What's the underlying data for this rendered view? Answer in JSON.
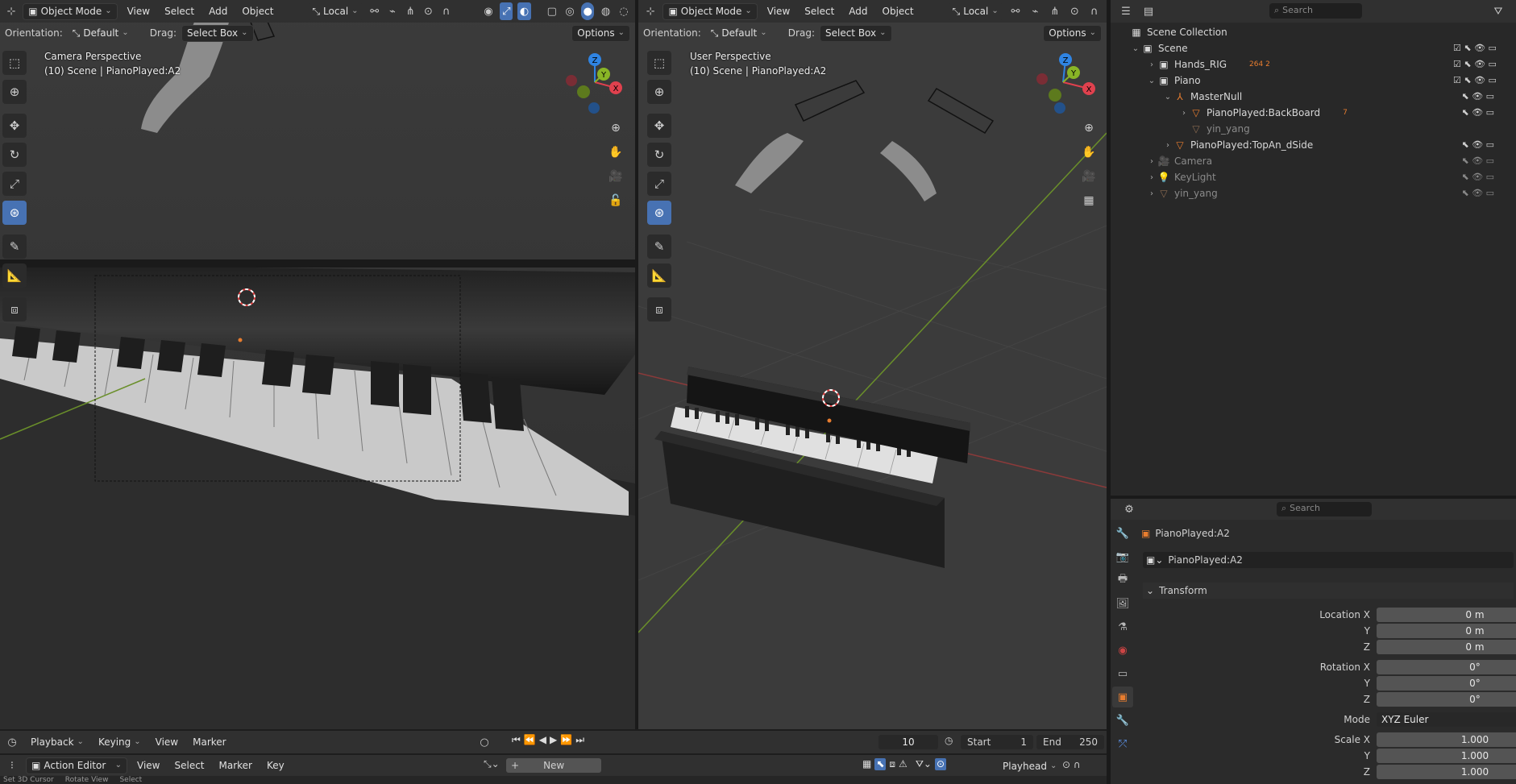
{
  "left_view": {
    "header": {
      "mode": "Object Mode",
      "menus": [
        "View",
        "Select",
        "Add",
        "Object"
      ],
      "transform_space": "Local"
    },
    "subheader": {
      "orientation_label": "Orientation:",
      "orientation_value": "Default",
      "drag_label": "Drag:",
      "drag_value": "Select Box",
      "options": "Options"
    },
    "overlay": {
      "view_name": "Camera Perspective",
      "scene_line": "(10) Scene | PianoPlayed:A2"
    },
    "gizmo": {
      "x": "X",
      "y": "Y",
      "z": "Z"
    }
  },
  "right_view": {
    "header": {
      "mode": "Object Mode",
      "menus": [
        "View",
        "Select",
        "Add",
        "Object"
      ],
      "transform_space": "Local"
    },
    "subheader": {
      "orientation_label": "Orientation:",
      "orientation_value": "Default",
      "drag_label": "Drag:",
      "drag_value": "Select Box",
      "options": "Options"
    },
    "overlay": {
      "view_name": "User Perspective",
      "scene_line": "(10) Scene | PianoPlayed:A2"
    },
    "gizmo": {
      "x": "X",
      "y": "Y",
      "z": "Z"
    }
  },
  "outliner": {
    "search_placeholder": "Search",
    "root": "Scene Collection",
    "rows": [
      {
        "label": "Scene",
        "badges": ""
      },
      {
        "label": "Hands_RIG",
        "badges": "264  2"
      },
      {
        "label": "Piano",
        "badges": ""
      },
      {
        "label": "MasterNull",
        "badges": ""
      },
      {
        "label": "PianoPlayed:BackBoard",
        "badges": "7"
      },
      {
        "label": "yin_yang",
        "badges": ""
      },
      {
        "label": "PianoPlayed:TopAn_dSide",
        "badges": ""
      },
      {
        "label": "Camera",
        "badges": ""
      },
      {
        "label": "KeyLight",
        "badges": ""
      },
      {
        "label": "yin_yang",
        "badges": ""
      }
    ]
  },
  "properties": {
    "search_placeholder": "Search",
    "object_name": "PianoPlayed:A2",
    "datablock_name": "PianoPlayed:A2",
    "panel_title": "Transform",
    "location": {
      "x_label": "Location X",
      "y_label": "Y",
      "z_label": "Z",
      "x": "0 m",
      "y": "0 m",
      "z": "0 m"
    },
    "rotation": {
      "x_label": "Rotation X",
      "y_label": "Y",
      "z_label": "Z",
      "x": "0°",
      "y": "0°",
      "z": "0°"
    },
    "mode": {
      "label": "Mode",
      "value": "XYZ Euler"
    },
    "scale": {
      "x_label": "Scale X",
      "y_label": "Y",
      "z_label": "Z",
      "x": "1.000",
      "y": "1.000",
      "z": "1.000"
    }
  },
  "timeline": {
    "menus": [
      "Playback",
      "Keying",
      "View",
      "Marker"
    ],
    "current_frame": "10",
    "start_label": "Start",
    "start": "1",
    "end_label": "End",
    "end": "250"
  },
  "action_editor": {
    "editor": "Action Editor",
    "menus": [
      "View",
      "Select",
      "Marker",
      "Key"
    ],
    "new_label": "New",
    "playhead": "Playhead"
  },
  "status_bar": {
    "items": [
      "Set 3D Cursor",
      "Rotate View",
      "Select"
    ]
  },
  "colors": {
    "accent": "#4772b3",
    "axis_x": "#e0414e",
    "axis_y": "#89b526",
    "axis_z": "#2f84e3",
    "object_orange": "#e87d2f"
  }
}
